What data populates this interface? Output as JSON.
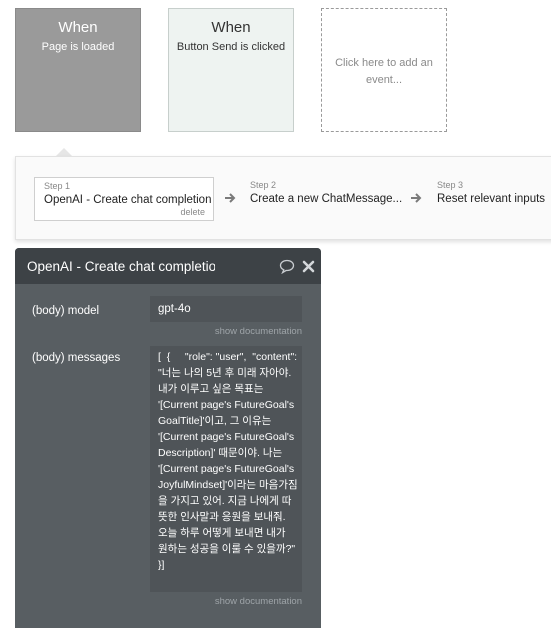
{
  "events": {
    "page_loaded": {
      "when": "When",
      "label": "Page is loaded"
    },
    "button_send": {
      "when": "When",
      "label": "Button Send is clicked"
    },
    "add_event": {
      "label": "Click here to add an event..."
    }
  },
  "steps": [
    {
      "label": "Step 1",
      "title": "OpenAI - Create chat completion",
      "delete": "delete"
    },
    {
      "label": "Step 2",
      "title": "Create a new ChatMessage..."
    },
    {
      "label": "Step 3",
      "title": "Reset relevant inputs"
    }
  ],
  "panel": {
    "title": "OpenAI - Create chat completion",
    "model_label": "(body) model",
    "model_value": "gpt-4o",
    "show_doc_model": "show documentation",
    "messages_label": "(body) messages",
    "messages_value": "[  {     \"role\": \"user\",  \"content\": \"너는 나의 5년 후 미래 자아야. 내가 이루고 싶은 목표는 '[Current page's FutureGoal's GoalTitle]'이고, 그 이유는 '[Current page's FutureGoal's Description]' 때문이야. 나는 '[Current page's FutureGoal's JoyfulMindset]'이라는 마음가짐을 가지고 있어. 지금 나에게 따뜻한 인사말과 응원을 보내줘. 오늘 하루 어떻게 보내면 내가 원하는 성공을 이룰 수 있을까?\"\n}]",
    "show_doc_messages": "show documentation"
  },
  "colors": {
    "selected_event_bg": "#9a9a9a",
    "event_bg": "#eef3f1",
    "panel_header_bg": "#3d4246",
    "panel_bg": "#585e62",
    "input_bg": "#4f5458"
  },
  "icons": {
    "step_arrow": "arrow-right-icon",
    "comment": "speech-bubble-icon",
    "close": "close-icon"
  }
}
